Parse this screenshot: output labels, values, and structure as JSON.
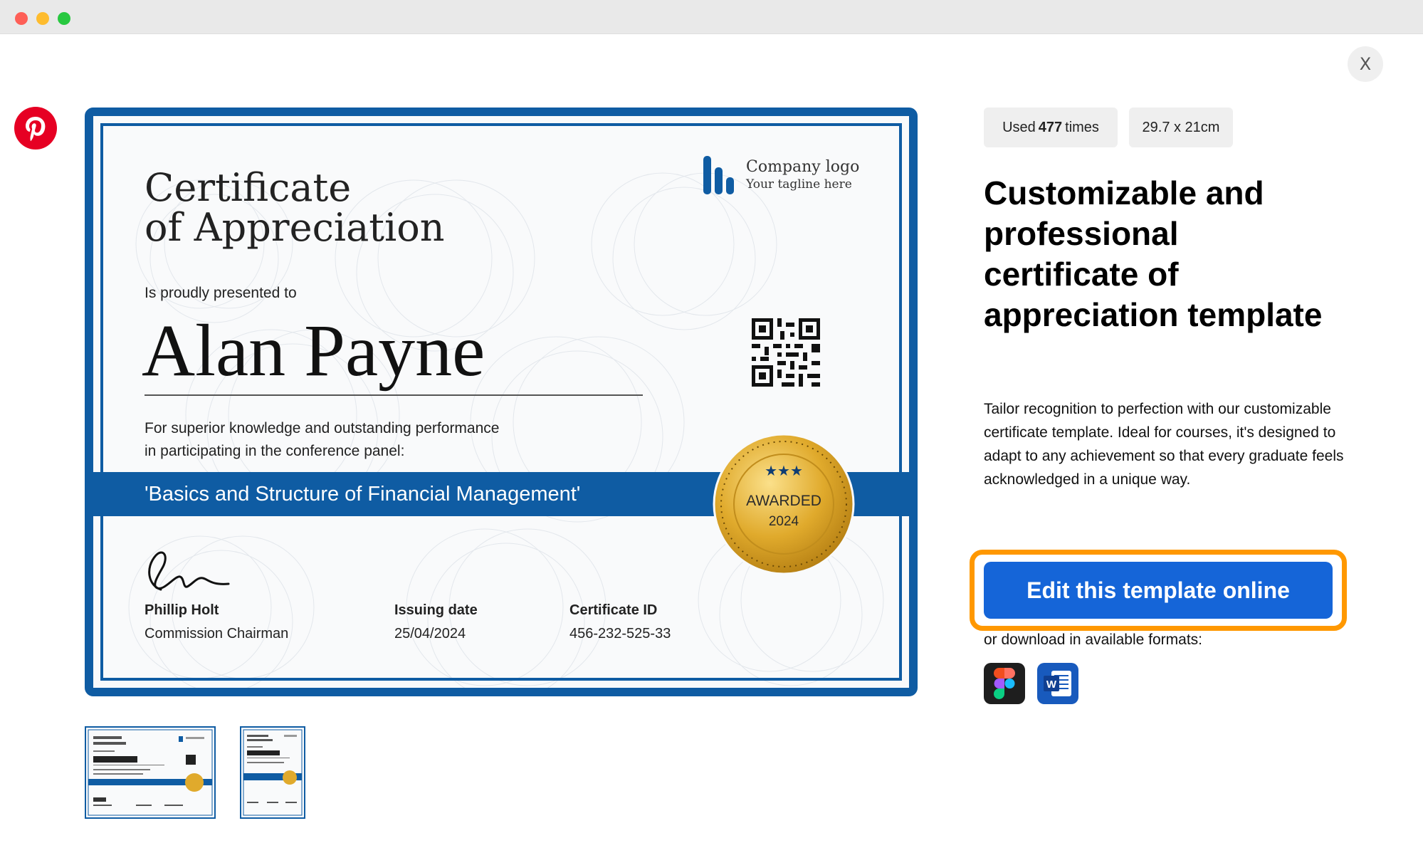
{
  "window": {
    "controls": [
      "close",
      "minimize",
      "zoom"
    ]
  },
  "icons": {
    "close": "close-icon",
    "pinterest": "pinterest-icon",
    "figma": "figma-icon",
    "word": "word-icon"
  },
  "colors": {
    "certificate_blue": "#0f5ca3",
    "button_blue": "#1565d8",
    "highlight_orange": "#ff9800",
    "pinterest_red": "#e60023",
    "seal_gold": "#d9a520"
  },
  "close_label": "X",
  "certificate": {
    "title_line1": "Certificate",
    "title_line2": "of Appreciation",
    "company_logo": "Company logo",
    "company_tagline": "Your tagline here",
    "presented_to": "Is proudly presented to",
    "recipient": "Alan Payne",
    "reason_line1": "For superior knowledge and outstanding performance",
    "reason_line2": "in participating in the conference panel:",
    "course": "'Basics and Structure of Financial Management'",
    "seal_label": "AWARDED",
    "seal_year": "2024",
    "signer_name": "Phillip Holt",
    "signer_role": "Commission Chairman",
    "issuing_label": "Issuing date",
    "issuing_date": "25/04/2024",
    "cert_id_label": "Certificate ID",
    "cert_id": "456-232-525-33"
  },
  "thumbnails": [
    {
      "orientation": "landscape"
    },
    {
      "orientation": "portrait"
    }
  ],
  "meta": {
    "used_prefix": "Used",
    "used_count": "477",
    "used_suffix": "times",
    "size": "29.7 x 21cm"
  },
  "heading": "Customizable and professional certificate of appreciation template",
  "description": "Tailor recognition to perfection with our customizable certificate template. Ideal for courses, it's designed to adapt to any achievement so that every graduate feels acknowledged in a unique way.",
  "cta": "Edit this template online",
  "download_text": "or download in available formats:",
  "formats": [
    "Figma",
    "Word"
  ]
}
